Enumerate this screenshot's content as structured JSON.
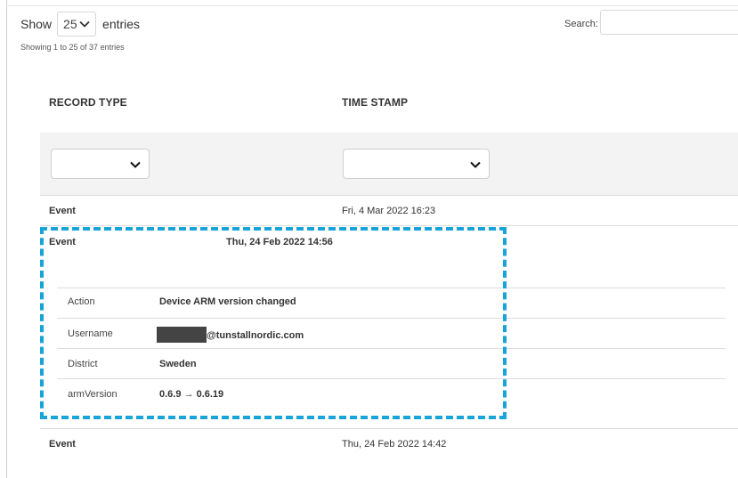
{
  "controls": {
    "show_label": "Show",
    "page_length": "25",
    "entries_label": "entries",
    "info": "Showing 1 to 25 of 37 entries",
    "search_label": "Search:",
    "search_value": ""
  },
  "columns": {
    "record_type": "RECORD TYPE",
    "time_stamp": "TIME STAMP"
  },
  "rows": [
    {
      "type": "Event",
      "time": "Fri, 4 Mar 2022 16:23"
    },
    {
      "type": "Event",
      "time": "Thu, 24 Feb 2022 14:56"
    },
    {
      "type": "Event",
      "time": "Thu, 24 Feb 2022 14:42"
    }
  ],
  "details": [
    {
      "label": "Action",
      "value": "Device ARM version changed"
    },
    {
      "label": "Username",
      "value": "@tunstallnordic.com"
    },
    {
      "label": "District",
      "value": "Sweden"
    },
    {
      "label": "armVersion",
      "value": "0.6.9 → 0.6.19"
    }
  ],
  "colors": {
    "highlight": "#18a3d9",
    "filter_band": "#f3f3f3"
  }
}
